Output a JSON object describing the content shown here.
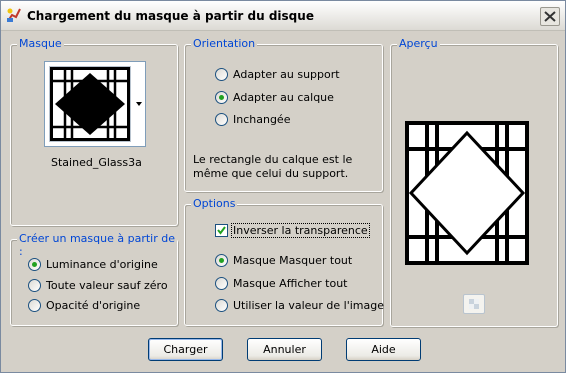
{
  "dialog": {
    "title": "Chargement du masque à partir du disque"
  },
  "masque": {
    "label": "Masque",
    "mask_name": "Stained_Glass3a"
  },
  "orientation": {
    "label": "Orientation",
    "options": [
      "Adapter au support",
      "Adapter au calque",
      "Inchangée"
    ],
    "selected": 1,
    "description": "Le rectangle du calque est le même que celui du support."
  },
  "apercu": {
    "label": "Aperçu"
  },
  "creer": {
    "label": "Créer un masque à partir de :",
    "options": [
      "Luminance d'origine",
      "Toute valeur sauf zéro",
      "Opacité d'origine"
    ],
    "selected": 0
  },
  "options": {
    "label": "Options",
    "invert_label": "Inverser la transparence",
    "invert_checked": true,
    "masque_options": [
      "Masque Masquer tout",
      "Masque Afficher tout",
      "Utiliser la valeur de l'image"
    ],
    "selected": 0
  },
  "buttons": {
    "charger": "Charger",
    "annuler": "Annuler",
    "aide": "Aide"
  },
  "colors": {
    "group_label": "#0046d5",
    "radio_checked": "#21a121"
  }
}
